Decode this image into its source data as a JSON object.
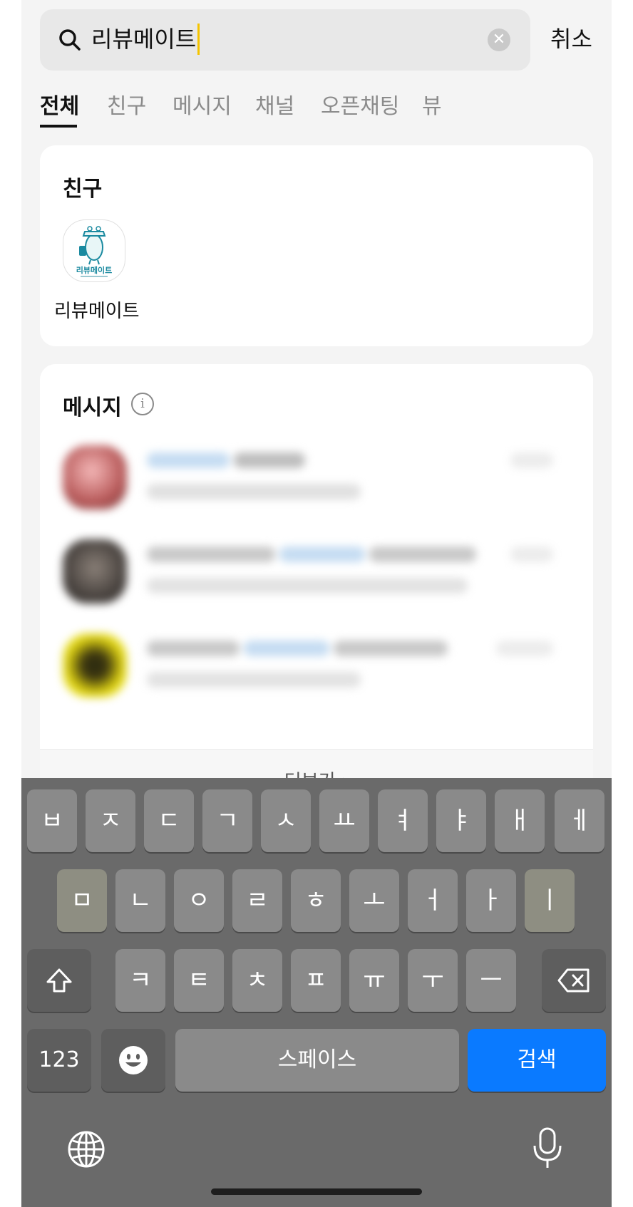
{
  "search": {
    "query": "리뷰메이트",
    "cancel_label": "취소"
  },
  "tabs": [
    {
      "label": "전체"
    },
    {
      "label": "친구"
    },
    {
      "label": "메시지"
    },
    {
      "label": "채널"
    },
    {
      "label": "오픈채팅"
    },
    {
      "label": "뷰"
    }
  ],
  "friends_section": {
    "title": "친구",
    "friend": {
      "name": "리뷰메이트",
      "logo_text": "리뷰메이트"
    }
  },
  "messages_section": {
    "title": "메시지",
    "more_label": "더보기 ›"
  },
  "keyboard": {
    "row1": [
      "ㅂ",
      "ㅈ",
      "ㄷ",
      "ㄱ",
      "ㅅ",
      "ㅛ",
      "ㅕ",
      "ㅑ",
      "ㅐ",
      "ㅔ"
    ],
    "row2": [
      "ㅁ",
      "ㄴ",
      "ㅇ",
      "ㄹ",
      "ㅎ",
      "ㅗ",
      "ㅓ",
      "ㅏ",
      "ㅣ"
    ],
    "row3": [
      "ㅋ",
      "ㅌ",
      "ㅊ",
      "ㅍ",
      "ㅠ",
      "ㅜ",
      "ㅡ"
    ],
    "num_label": "123",
    "space_label": "스페이스",
    "search_label": "검색"
  },
  "colors": {
    "accent": "#0a7aff",
    "caret": "#f5c400",
    "teal_logo": "#1b8aa0"
  }
}
